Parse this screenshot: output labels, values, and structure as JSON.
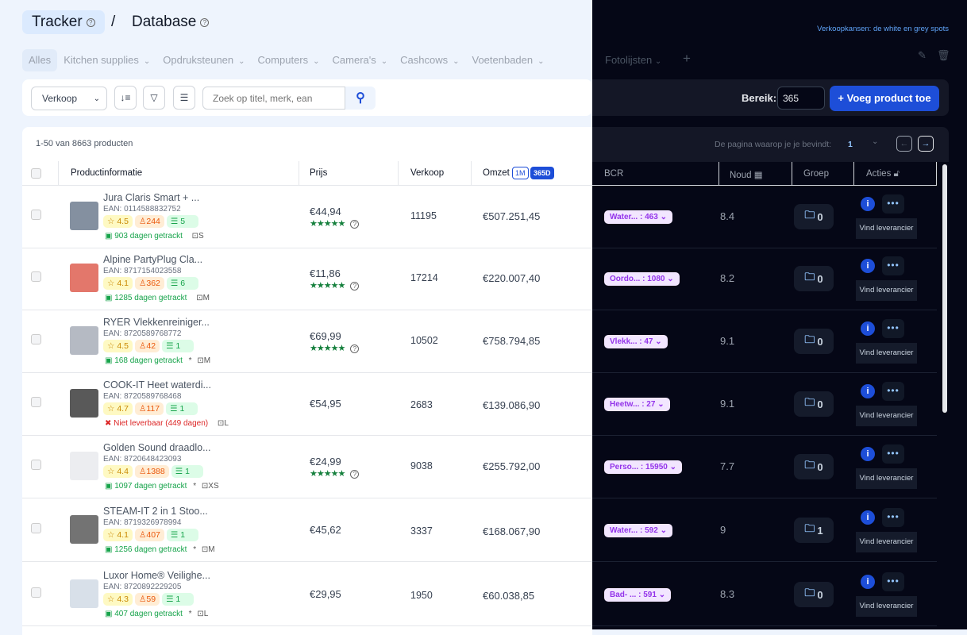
{
  "breadcrumb": {
    "tracker": "Tracker",
    "sep": "/",
    "database": "Database",
    "help": "?"
  },
  "promo_link": "Verkoopkansen: de white en grey spots",
  "tabs": [
    {
      "label": "Alles"
    },
    {
      "label": "Kitchen supplies"
    },
    {
      "label": "Opdruksteunen"
    },
    {
      "label": "Computers"
    },
    {
      "label": "Camera's"
    },
    {
      "label": "Cashcows"
    },
    {
      "label": "Voetenbaden"
    },
    {
      "label": "Fotolijsten"
    }
  ],
  "tab_chevron": "⌄",
  "add_tab": "+",
  "toolbar": {
    "sort_select": "Verkoop",
    "search_placeholder": "Zoek op titel, merk, ean",
    "range_label": "Bereik:",
    "range_value": "365",
    "add_button": "+ Voeg product toe"
  },
  "pagination": {
    "count": "1-50 van 8663 producten",
    "page_label": "De pagina waarop je je bevindt:",
    "page": "1"
  },
  "columns": {
    "product": "Productinformatie",
    "price": "Prijs",
    "sales": "Verkoop",
    "revenue": "Omzet",
    "rev_1m": "1M",
    "rev_365": "365D",
    "bcr": "BCR",
    "noud": "Noud",
    "group": "Groep",
    "actions": "Acties"
  },
  "row_action": "Vind leverancier",
  "accent": "#1d4ed8",
  "rows": [
    {
      "title": "Jura Claris Smart + ...",
      "ean": "EAN: 0114588832752",
      "rating": "4.5",
      "reviews": "244",
      "sellers": "5",
      "tracked": "903 dagen getrackt",
      "tracked_ok": true,
      "star_mark": "",
      "size": "S",
      "price": "€44,94",
      "stars": true,
      "sales": "11195",
      "revenue": "€507.251,45",
      "bcr": "Water... : 463",
      "noud": "8.4",
      "group": "0"
    },
    {
      "title": "Alpine PartyPlug Cla...",
      "ean": "EAN: 8717154023558",
      "rating": "4.1",
      "reviews": "362",
      "sellers": "6",
      "tracked": "1285 dagen getrackt",
      "tracked_ok": true,
      "star_mark": "",
      "size": "M",
      "price": "€11,86",
      "stars": true,
      "sales": "17214",
      "revenue": "€220.007,40",
      "bcr": "Oordo... : 1080",
      "noud": "8.2",
      "group": "0"
    },
    {
      "title": "RYER Vlekkenreiniger...",
      "ean": "EAN: 8720589768772",
      "rating": "4.5",
      "reviews": "42",
      "sellers": "1",
      "tracked": "168 dagen getrackt",
      "tracked_ok": true,
      "star_mark": "*",
      "size": "M",
      "price": "€69,99",
      "stars": true,
      "sales": "10502",
      "revenue": "€758.794,85",
      "bcr": "Vlekk... : 47",
      "noud": "9.1",
      "group": "0"
    },
    {
      "title": "COOK-IT Heet waterdi...",
      "ean": "EAN: 8720589768468",
      "rating": "4.7",
      "reviews": "117",
      "sellers": "1",
      "tracked": "Niet leverbaar (449 dagen)",
      "tracked_ok": false,
      "star_mark": "",
      "size": "L",
      "price": "€54,95",
      "stars": false,
      "sales": "2683",
      "revenue": "€139.086,90",
      "bcr": "Heetw... : 27",
      "noud": "9.1",
      "group": "0"
    },
    {
      "title": "Golden Sound draadlo...",
      "ean": "EAN: 8720648423093",
      "rating": "4.4",
      "reviews": "1388",
      "sellers": "1",
      "tracked": "1097 dagen getrackt",
      "tracked_ok": true,
      "star_mark": "*",
      "size": "XS",
      "price": "€24,99",
      "stars": true,
      "sales": "9038",
      "revenue": "€255.792,00",
      "bcr": "Perso... : 15950",
      "noud": "7.7",
      "group": "0"
    },
    {
      "title": "STEAM-IT 2 in 1 Stoo...",
      "ean": "EAN: 8719326978994",
      "rating": "4.1",
      "reviews": "407",
      "sellers": "1",
      "tracked": "1256 dagen getrackt",
      "tracked_ok": true,
      "star_mark": "*",
      "size": "M",
      "price": "€45,62",
      "stars": false,
      "sales": "3337",
      "revenue": "€168.067,90",
      "bcr": "Water... : 592",
      "noud": "9",
      "group": "1"
    },
    {
      "title": "Luxor Home® Veilighe...",
      "ean": "EAN: 8720892229205",
      "rating": "4.3",
      "reviews": "59",
      "sellers": "1",
      "tracked": "407 dagen getrackt",
      "tracked_ok": true,
      "star_mark": "*",
      "size": "L",
      "price": "€29,95",
      "stars": false,
      "sales": "1950",
      "revenue": "€60.038,85",
      "bcr": "Bad- ... : 591",
      "noud": "8.3",
      "group": "0"
    }
  ]
}
